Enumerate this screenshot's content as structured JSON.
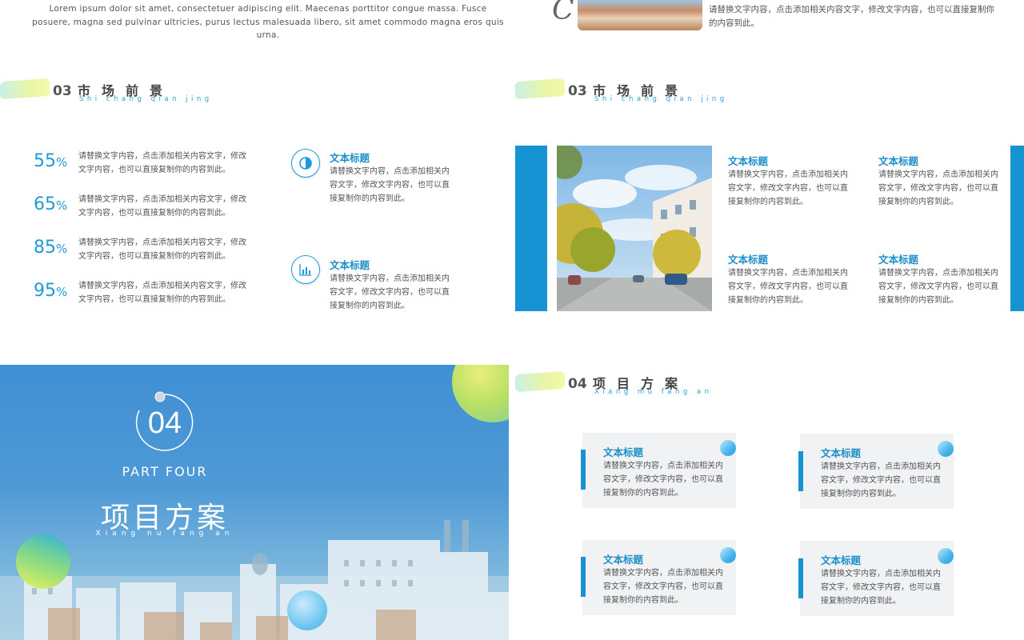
{
  "top": {
    "lorem": "Lorem ipsum dolor sit amet, consectetuer adipiscing elit. Maecenas porttitor congue massa. Fusce posuere, magna sed pulvinar ultricies, purus lectus malesuada libero, sit amet commodo magna eros quis urna.",
    "right_text": "请替换文字内容，点击添加相关内容文字，修改文字内容，也可以直接复制你的内容到此。",
    "right_letter": "C"
  },
  "slide1": {
    "num": "03",
    "title": "市场前景",
    "pinyin": "Shi chang qian jing",
    "stats": [
      {
        "value": "55",
        "unit": "%",
        "text": "请替换文字内容，点击添加相关内容文字，修改文字内容，也可以直接复制你的内容到此。"
      },
      {
        "value": "65",
        "unit": "%",
        "text": "请替换文字内容，点击添加相关内容文字，修改文字内容，也可以直接复制你的内容到此。"
      },
      {
        "value": "85",
        "unit": "%",
        "text": "请替换文字内容，点击添加相关内容文字，修改文字内容，也可以直接复制你的内容到此。"
      },
      {
        "value": "95",
        "unit": "%",
        "text": "请替换文字内容，点击添加相关内容文字，修改文字内容，也可以直接复制你的内容到此。"
      }
    ],
    "features": [
      {
        "icon": "half-circle-icon",
        "title": "文本标题",
        "text": "请替换文字内容，点击添加相关内容文字，修改文字内容，也可以直接复制你的内容到此。"
      },
      {
        "icon": "bar-chart-icon",
        "title": "文本标题",
        "text": "请替换文字内容，点击添加相关内容文字，修改文字内容，也可以直接复制你的内容到此。"
      }
    ]
  },
  "slide2": {
    "num": "03",
    "title": "市场前景",
    "pinyin": "Shi chang qian jing",
    "items": [
      {
        "title": "文本标题",
        "text": "请替换文字内容，点击添加相关内容文字，修改文字内容，也可以直接复制你的内容到此。"
      },
      {
        "title": "文本标题",
        "text": "请替换文字内容，点击添加相关内容文字，修改文字内容，也可以直接复制你的内容到此。"
      },
      {
        "title": "文本标题",
        "text": "请替换文字内容，点击添加相关内容文字，修改文字内容，也可以直接复制你的内容到此。"
      },
      {
        "title": "文本标题",
        "text": "请替换文字内容，点击添加相关内容文字，修改文字内容，也可以直接复制你的内容到此。"
      }
    ]
  },
  "slide3": {
    "num": "04",
    "part": "PART FOUR",
    "title": "项目方案",
    "pinyin": "Xiang nu fang an"
  },
  "slide4": {
    "num": "04",
    "title": "项目方案",
    "pinyin": "Xiang mu fang an",
    "cards": [
      {
        "title": "文本标题",
        "text": "请替换文字内容，点击添加相关内容文字，修改文字内容，也可以直接复制你的内容到此。"
      },
      {
        "title": "文本标题",
        "text": "请替换文字内容，点击添加相关内容文字，修改文字内容，也可以直接复制你的内容到此。"
      },
      {
        "title": "文本标题",
        "text": "请替换文字内容，点击添加相关内容文字，修改文字内容，也可以直接复制你的内容到此。"
      },
      {
        "title": "文本标题",
        "text": "请替换文字内容，点击添加相关内容文字，修改文字内容，也可以直接复制你的内容到此。"
      }
    ]
  },
  "colors": {
    "accent": "#1e9bd7",
    "bar": "#1593d2",
    "card": "#f1f2f4"
  }
}
